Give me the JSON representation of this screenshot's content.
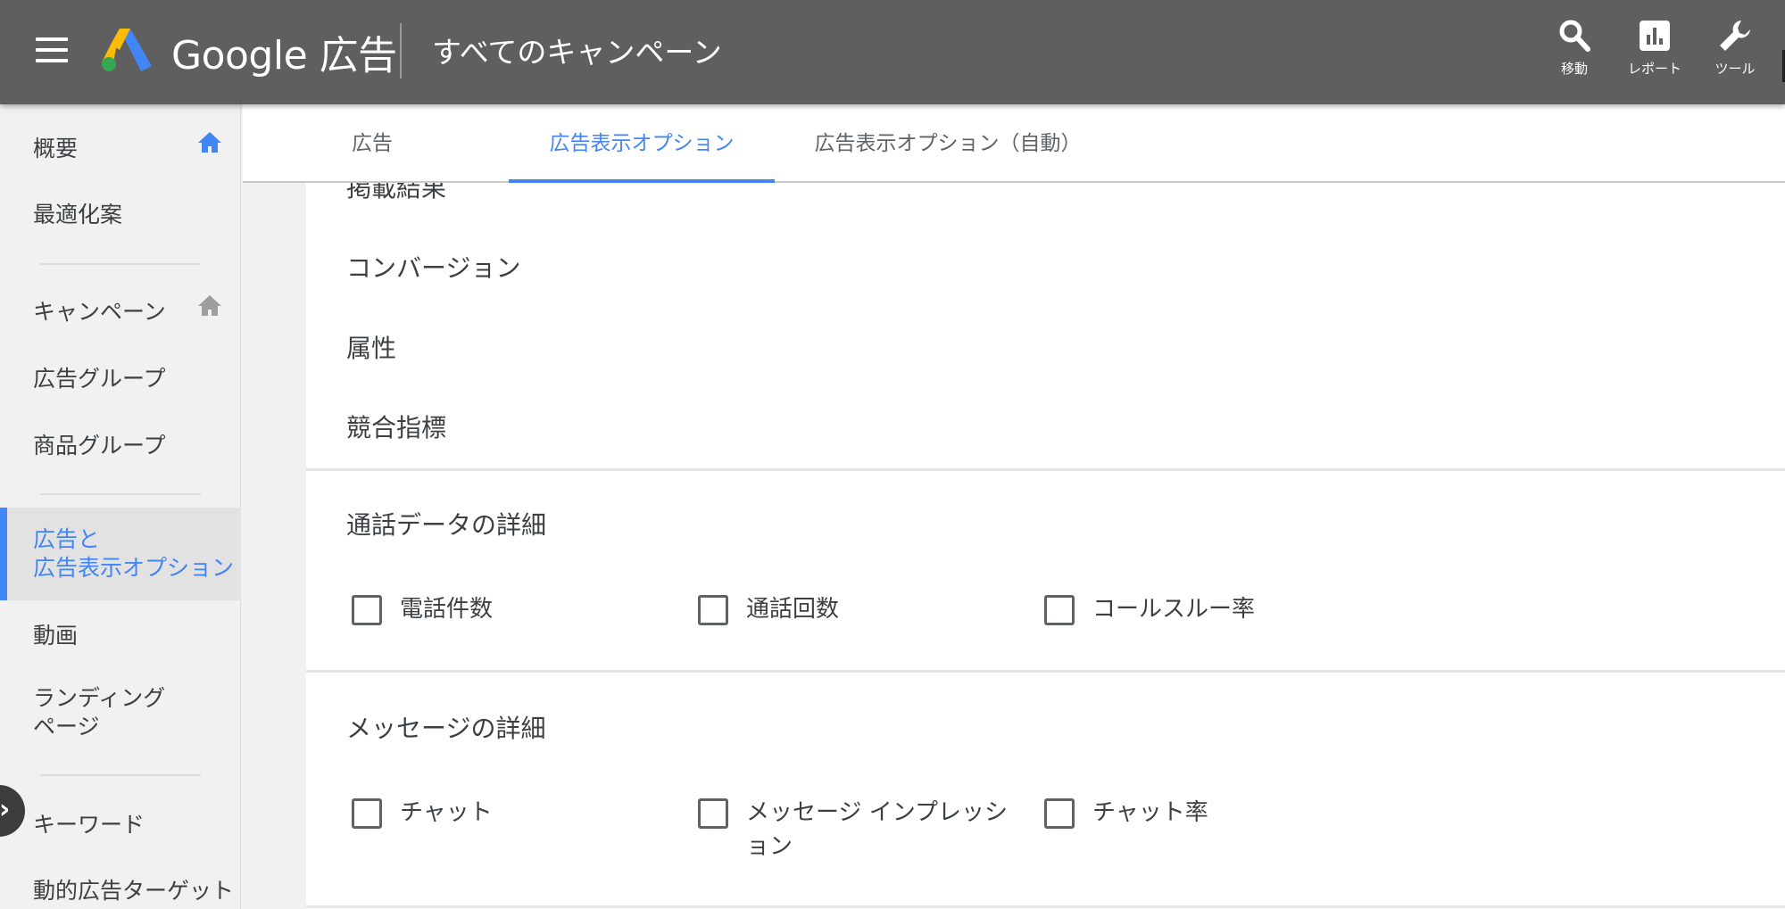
{
  "header": {
    "brand": "Google 広告",
    "page_title": "すべてのキャンペーン",
    "actions": [
      {
        "icon": "search-icon",
        "label": "移動"
      },
      {
        "icon": "report-icon",
        "label": "レポート"
      },
      {
        "icon": "wrench-icon",
        "label": "ツール"
      }
    ]
  },
  "sidebar": {
    "items": [
      {
        "label": "概要"
      },
      {
        "label": "最適化案"
      },
      {
        "label": "キャンペーン"
      },
      {
        "label": "広告グループ"
      },
      {
        "label": "商品グループ"
      },
      {
        "label_line1": "広告と",
        "label_line2": "広告表示オプション"
      },
      {
        "label": "動画"
      },
      {
        "label_line1": "ランディング",
        "label_line2": "ページ"
      },
      {
        "label": "キーワード"
      },
      {
        "label": "動的広告ターゲット"
      }
    ]
  },
  "tabs": [
    {
      "label": "広告"
    },
    {
      "label": "広告表示オプション"
    },
    {
      "label": "広告表示オプション（自動）"
    }
  ],
  "content": {
    "partial_item": "掲載結果",
    "items": [
      "コンバージョン",
      "属性",
      "競合指標"
    ],
    "call_section": {
      "title": "通話データの詳細",
      "options": [
        "電話件数",
        "通話回数",
        "コールスルー率"
      ]
    },
    "message_section": {
      "title": "メッセージの詳細",
      "options": [
        "チャット",
        "メッセージ インプレッション",
        "チャット率"
      ]
    }
  },
  "colors": {
    "accent": "#4285f4",
    "topbar": "#5f5f5f",
    "active_nav_bg": "#e2e2e2",
    "home_icon_active": "#4285f4",
    "home_icon_inactive": "#9e9e9e"
  }
}
